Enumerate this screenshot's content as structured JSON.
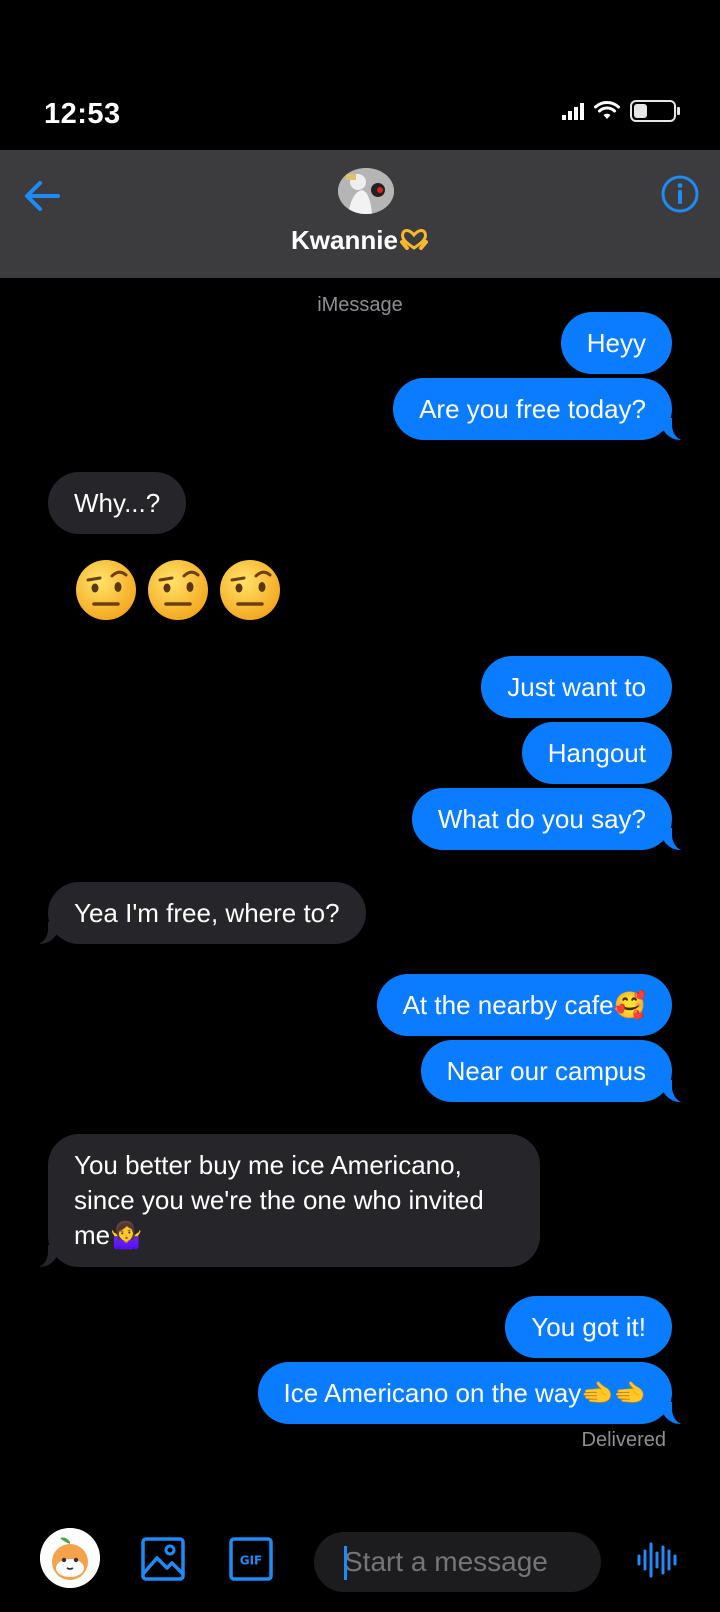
{
  "status": {
    "time": "12:53",
    "battery_level": 0.35
  },
  "header": {
    "contact_name": "Kwannie",
    "contact_emoji_icon": "heart-hands-icon"
  },
  "chat": {
    "service_label": "iMessage",
    "messages": [
      {
        "from": "me",
        "text": "Heyy"
      },
      {
        "from": "me",
        "text": "Are you free today?"
      },
      {
        "from": "them",
        "text": "Why...?"
      },
      {
        "from": "them",
        "text": "🤨🤨🤨"
      },
      {
        "from": "me",
        "text": "Just want to"
      },
      {
        "from": "me",
        "text": "Hangout"
      },
      {
        "from": "me",
        "text": "What do you say?"
      },
      {
        "from": "them",
        "text": "Yea I'm free, where to?"
      },
      {
        "from": "me",
        "text": "At the nearby cafe🥰"
      },
      {
        "from": "me",
        "text": "Near our campus"
      },
      {
        "from": "them",
        "text": "You better buy me ice Americano, since you we're the one who invited me🤷‍♀️"
      },
      {
        "from": "me",
        "text": "You got it!"
      },
      {
        "from": "me",
        "text": "Ice Americano on the way🫲🫲"
      }
    ],
    "delivery_status": "Delivered"
  },
  "composer": {
    "placeholder": "Start a message",
    "gif_label": "GIF"
  },
  "colors": {
    "accent": "#0a7cff",
    "received_bubble": "#26252a",
    "header_bg": "#3c3c3e",
    "icon_blue": "#1d8cf8"
  }
}
